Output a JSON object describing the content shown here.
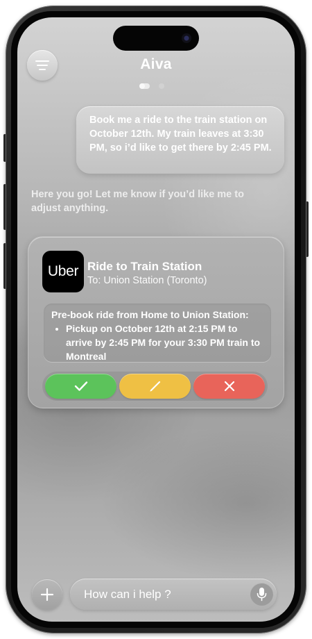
{
  "app": {
    "title": "Aiva"
  },
  "chat": {
    "user_message": "Book me a ride to the train station on October 12th. My train leaves at 3:30 PM, so i’d like to get there by 2:45 PM.",
    "assistant_message": "Here you go! Let me know if you’d like me to adjust anything."
  },
  "ride_card": {
    "logo_text": "Uber",
    "title": "Ride to Train Station",
    "subtitle": "To: Union Station (Toronto)",
    "details_heading": "Pre-book ride from Home to Union Station:",
    "details_items": [
      "Pickup on October 12th at 2:15 PM to arrive by 2:45 PM for your 3:30 PM train to Montreal"
    ],
    "actions": [
      {
        "name": "confirm",
        "icon": "checkmark-icon",
        "color": "#5cc35b"
      },
      {
        "name": "edit",
        "icon": "pencil-icon",
        "color": "#efc044"
      },
      {
        "name": "cancel",
        "icon": "close-icon",
        "color": "#e8645a"
      }
    ]
  },
  "composer": {
    "placeholder": "How can i help ?",
    "plus_icon": "plus-icon",
    "mic_icon": "microphone-icon"
  },
  "header": {
    "menu_icon": "menu-icon",
    "page_indicator": {
      "count": 2,
      "active_index": 0
    }
  }
}
